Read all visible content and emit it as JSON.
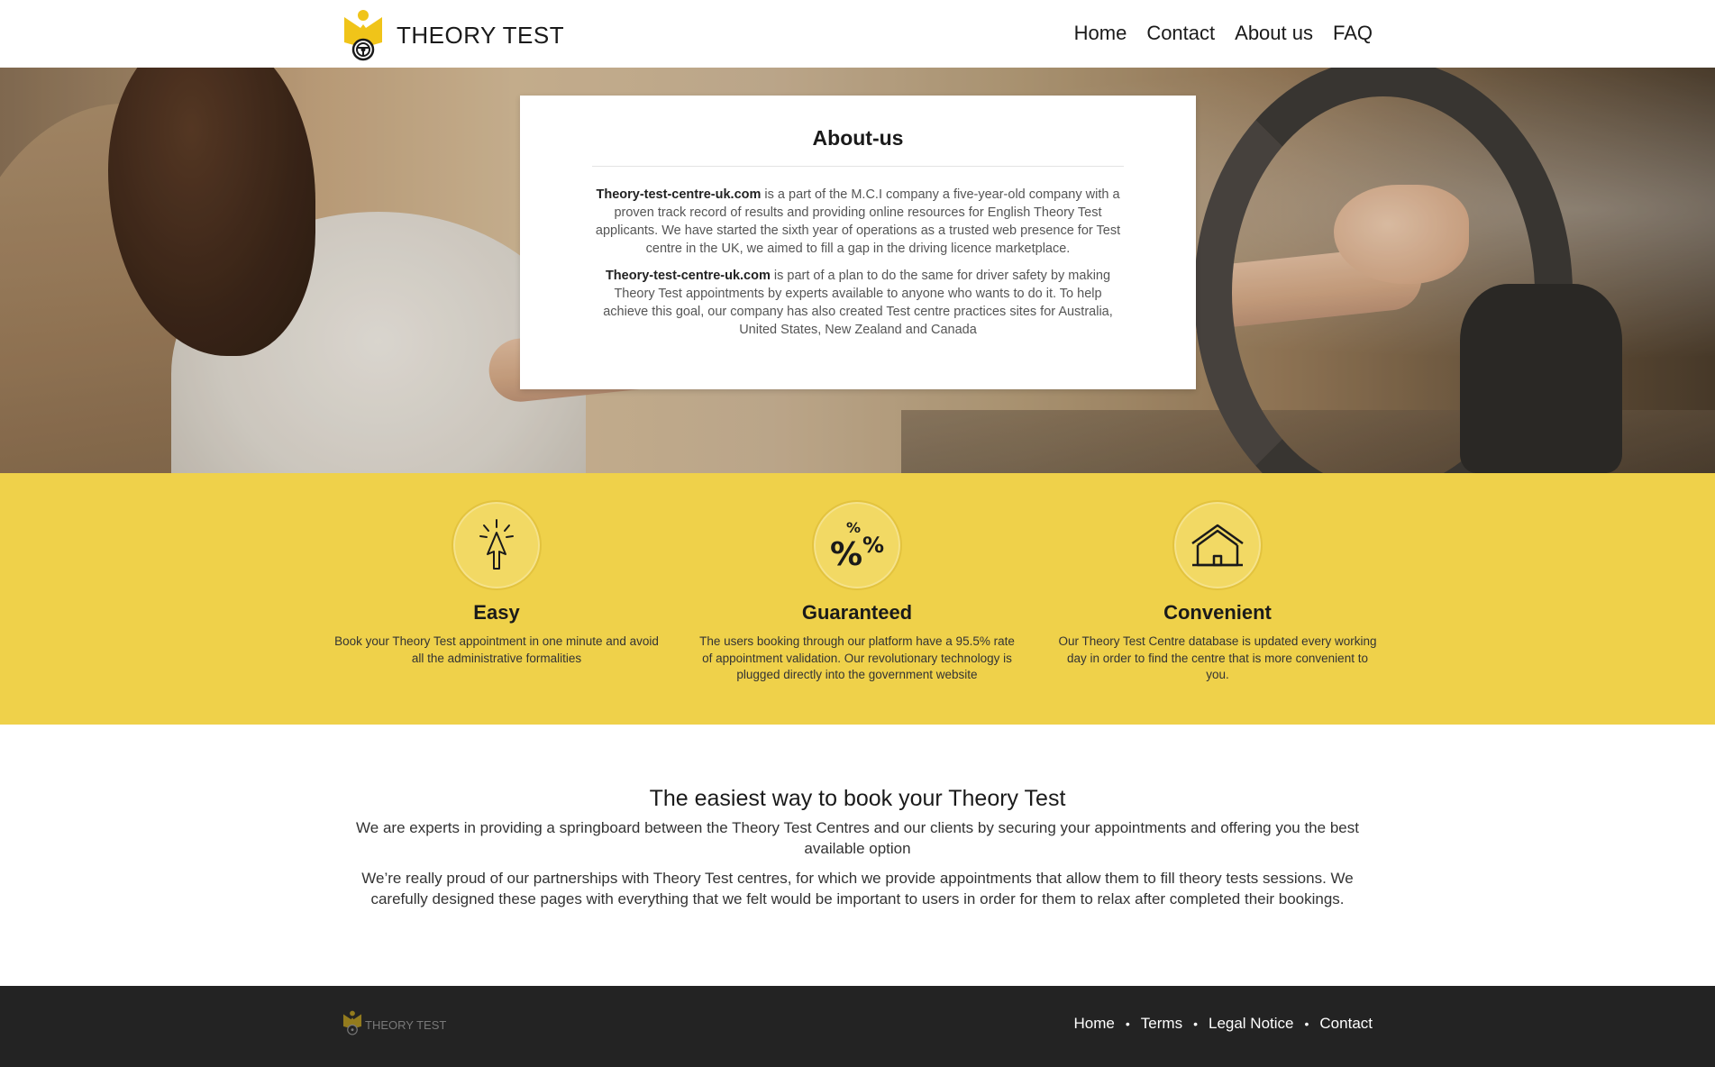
{
  "header": {
    "logo_text": "THEORY TEST",
    "nav": [
      "Home",
      "Contact",
      "About us",
      "FAQ"
    ]
  },
  "about": {
    "title": "About-us",
    "p1_bold": "Theory-test-centre-uk.com",
    "p1_text": " is a part of the M.C.I company a five-year-old company with a proven track record of results and providing online resources for English Theory Test applicants. We have started the sixth year of operations as a trusted web presence for Test centre in the UK, we aimed to fill a gap in the driving licence marketplace.",
    "p2_bold": "Theory-test-centre-uk.com",
    "p2_text": " is part of a plan to do the same for driver safety by making Theory Test appointments by experts available to anyone who wants to do it. To help achieve this goal, our company has also created Test centre practices sites for Australia, United States, New Zealand and Canada"
  },
  "features": [
    {
      "icon": "pointer-click-icon",
      "title": "Easy",
      "text": "Book your Theory Test appointment in one minute and avoid all the administrative formalities"
    },
    {
      "icon": "percent-icon",
      "title": "Guaranteed",
      "text": "The users booking through our platform have a 95.5% rate of appointment validation. Our revolutionary technology is plugged directly into the government website"
    },
    {
      "icon": "house-icon",
      "title": "Convenient",
      "text": "Our Theory Test Centre database is updated every working day in order to find the centre that is more convenient to you."
    }
  ],
  "info": {
    "title": "The easiest way to book your Theory Test",
    "p1": "We are experts in providing a springboard between the Theory Test Centres and our clients by securing your appointments and offering you the best available option",
    "p2": "We’re really proud of our partnerships with Theory Test centres, for which we provide appointments that allow them to fill theory tests sessions. We carefully designed these pages with everything that we felt would be important to users in order for them to relax after completed their bookings."
  },
  "footer": {
    "logo_text": "THEORY TEST",
    "links": [
      "Home",
      "Terms",
      "Legal Notice",
      "Contact"
    ],
    "separator": "•"
  },
  "colors": {
    "accent_yellow": "#efd14a",
    "footer_bg": "#232323"
  }
}
